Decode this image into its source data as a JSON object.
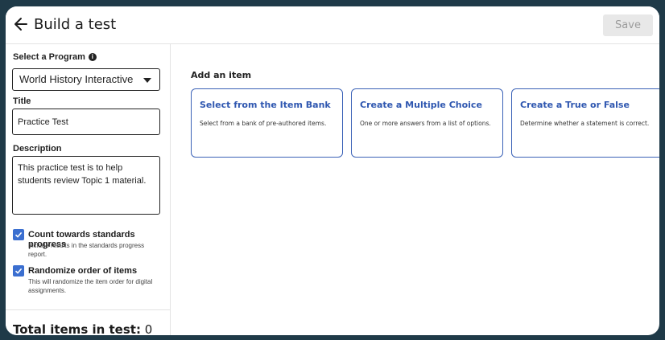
{
  "header": {
    "title": "Build a test",
    "save_label": "Save"
  },
  "sidebar": {
    "program_label": "Select a Program",
    "program_value": "World History Interactive",
    "title_label": "Title",
    "title_value": "Practice Test",
    "description_label": "Description",
    "description_value": "This practice test is to help students review Topic 1 material.",
    "options": [
      {
        "label": "Count towards standards progress",
        "description": "Include results in the standards progress report.",
        "checked": true
      },
      {
        "label": "Randomize order of items",
        "description": "This will randomize the item order for digital assignments.",
        "checked": true
      }
    ],
    "total_label": "Total items in test:",
    "total_value": "0"
  },
  "main": {
    "heading": "Add an item",
    "cards": [
      {
        "title": "Select from the Item Bank",
        "description": "Select from a bank of pre-authored items."
      },
      {
        "title": "Create a Multiple Choice",
        "description": "One or more answers from a list of options."
      },
      {
        "title": "Create a True or False",
        "description": "Determine whether a statement is correct."
      }
    ]
  },
  "colors": {
    "accent": "#3b62b7",
    "checkbox": "#3b6fd0",
    "frame_background": "#1f3a48"
  },
  "icons": [
    "back-arrow-icon",
    "info-icon",
    "chevron-down-icon",
    "checkmark-icon"
  ]
}
